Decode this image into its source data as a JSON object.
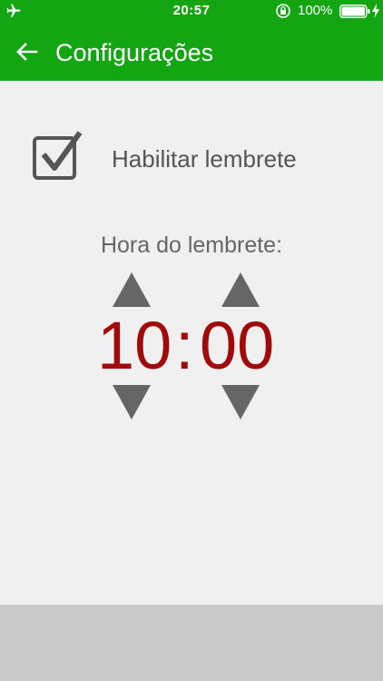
{
  "status_bar": {
    "time": "20:57",
    "battery_percent": "100%",
    "icons": [
      "airplane-icon",
      "orientation-lock-icon",
      "battery-icon",
      "charging-icon"
    ]
  },
  "app_bar": {
    "back_icon": "arrow-left-icon",
    "title": "Configurações"
  },
  "reminder": {
    "enabled": true,
    "label": "Habilitar lembrete",
    "time_label": "Hora do lembrete:",
    "hours": "10",
    "separator": ":",
    "minutes": "00"
  },
  "colors": {
    "primary_green": "#13a512",
    "time_red": "#a10a0a",
    "arrow_gray": "#666666",
    "background": "#f0f0f0",
    "bottom_bar": "#c9c9c9"
  }
}
